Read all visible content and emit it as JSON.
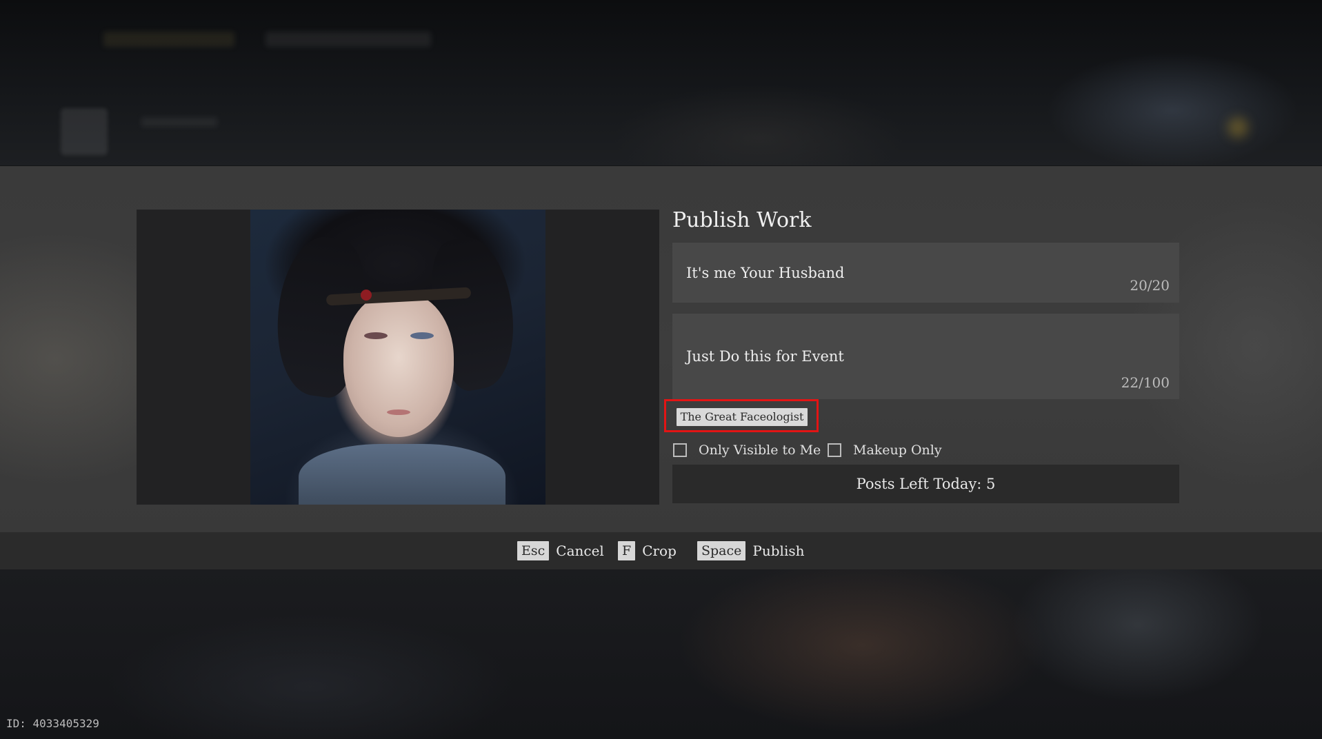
{
  "dialog": {
    "title": "Publish Work",
    "title_field": {
      "value": "It's me Your Husband",
      "counter": "20/20"
    },
    "description_field": {
      "value": "Just Do this for Event",
      "counter": "22/100"
    },
    "tag": "The Great Faceologist",
    "options": [
      {
        "label": "Only Visible to Me",
        "checked": false
      },
      {
        "label": "Makeup Only",
        "checked": false
      }
    ],
    "posts_left": "Posts Left Today: 5"
  },
  "hints": {
    "cancel": {
      "key": "Esc",
      "label": "Cancel"
    },
    "crop": {
      "key": "F",
      "label": "Crop"
    },
    "publish": {
      "key": "Space",
      "label": "Publish"
    }
  },
  "footer": {
    "id": "ID: 4033405329"
  },
  "colors": {
    "highlight": "#e31414",
    "panel": "#3c3c3c",
    "field": "#484848",
    "chip": "#d9d9d9"
  }
}
